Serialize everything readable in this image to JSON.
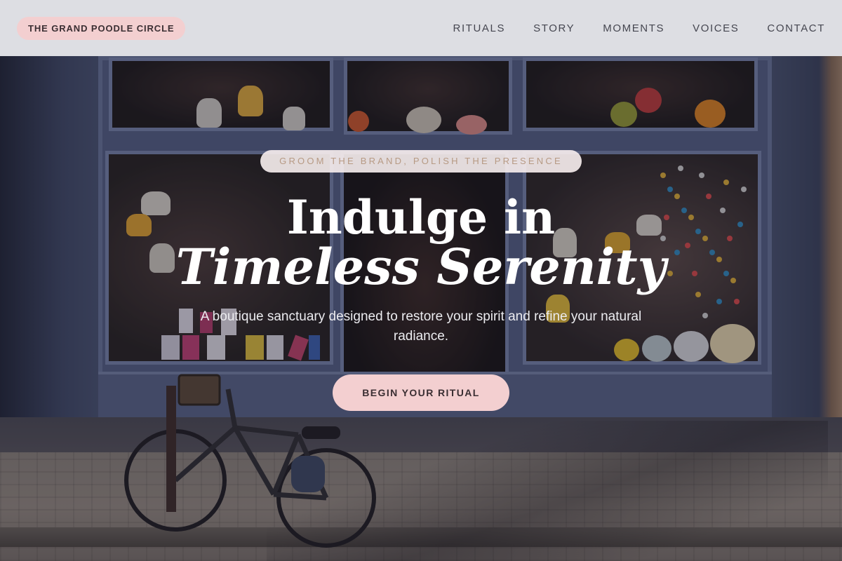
{
  "header": {
    "brand": "THE GRAND POODLE CIRCLE",
    "nav": [
      "RITUALS",
      "STORY",
      "MOMENTS",
      "VOICES",
      "CONTACT"
    ]
  },
  "hero": {
    "eyebrow": "GROOM THE BRAND, POLISH THE PRESENCE",
    "headline_line1": "Indulge in",
    "headline_line2": "Timeless Serenity",
    "subtext": "A boutique sanctuary designed to restore your spirit and refine your natural radiance.",
    "cta": "BEGIN YOUR RITUAL",
    "background_image": "storefront with hanging lamps and a parked bicycle"
  },
  "colors": {
    "header_bg": "#ececf0",
    "pill_pink": "#f3cfd0",
    "eyebrow_text": "#b79a84",
    "nav_text": "#454650"
  }
}
